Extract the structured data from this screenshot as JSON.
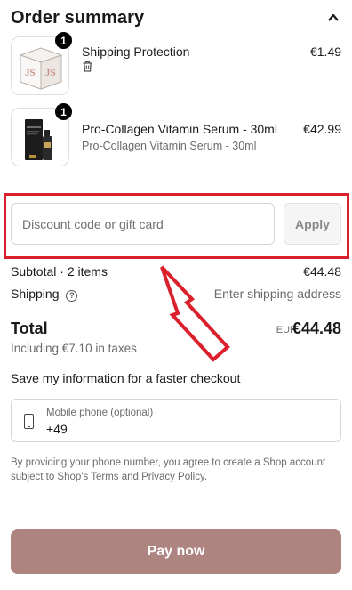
{
  "header": {
    "title": "Order summary"
  },
  "items": [
    {
      "name": "Shipping Protection",
      "variant": "",
      "price": "€1.49",
      "qty": "1"
    },
    {
      "name": "Pro-Collagen Vitamin Serum - 30ml",
      "variant": "Pro-Collagen Vitamin Serum - 30ml",
      "price": "€42.99",
      "qty": "1"
    }
  ],
  "discount": {
    "placeholder": "Discount code or gift card",
    "apply_label": "Apply"
  },
  "summary": {
    "subtotal_label": "Subtotal · 2 items",
    "subtotal_value": "€44.48",
    "shipping_label": "Shipping",
    "shipping_value": "Enter shipping address",
    "total_label": "Total",
    "currency": "EUR",
    "total_value": "€44.48",
    "taxes": "Including €7.10 in taxes"
  },
  "save_info": {
    "label": "Save my information for a faster checkout"
  },
  "phone": {
    "label": "Mobile phone (optional)",
    "value": "+49"
  },
  "terms": {
    "prefix": "By providing your phone number, you agree to create a Shop account subject to Shop's",
    "terms_link": "Terms",
    "and": "and",
    "privacy_link": "Privacy Policy",
    "suffix": "."
  },
  "pay": {
    "label": "Pay now"
  },
  "colors": {
    "highlight": "#d9202c",
    "pay_button": "#ae8480",
    "logo_text": "#c9928a"
  },
  "logo_text": "JS"
}
